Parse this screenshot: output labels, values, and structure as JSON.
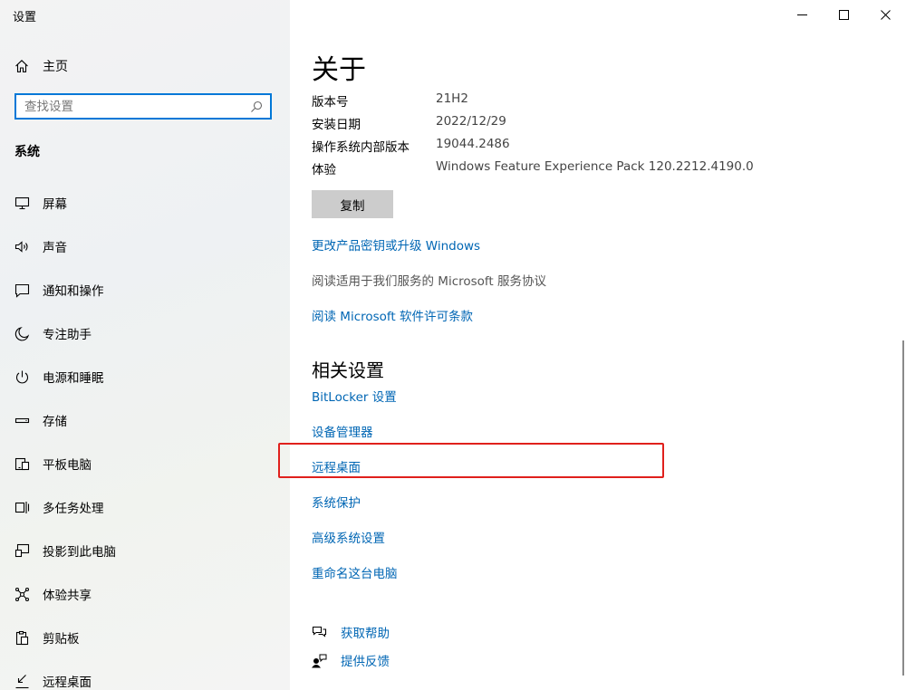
{
  "window": {
    "title": "设置"
  },
  "sidebar": {
    "home_label": "主页",
    "search_placeholder": "查找设置",
    "section": "系统",
    "items": [
      {
        "label": "屏幕",
        "icon": "monitor-icon"
      },
      {
        "label": "声音",
        "icon": "speaker-icon"
      },
      {
        "label": "通知和操作",
        "icon": "notification-icon"
      },
      {
        "label": "专注助手",
        "icon": "moon-icon"
      },
      {
        "label": "电源和睡眠",
        "icon": "power-icon"
      },
      {
        "label": "存储",
        "icon": "storage-icon"
      },
      {
        "label": "平板电脑",
        "icon": "tablet-icon"
      },
      {
        "label": "多任务处理",
        "icon": "multitasking-icon"
      },
      {
        "label": "投影到此电脑",
        "icon": "project-icon"
      },
      {
        "label": "体验共享",
        "icon": "share-icon"
      },
      {
        "label": "剪贴板",
        "icon": "clipboard-icon"
      },
      {
        "label": "远程桌面",
        "icon": "remote-desktop-icon"
      }
    ]
  },
  "main": {
    "title": "关于",
    "specs": [
      {
        "key": "版本号",
        "value": "21H2"
      },
      {
        "key": "安装日期",
        "value": "2022/12/29"
      },
      {
        "key": "操作系统内部版本",
        "value": "19044.2486"
      },
      {
        "key": "体验",
        "value": "Windows Feature Experience Pack 120.2212.4190.0"
      }
    ],
    "copy_label": "复制",
    "link_product_key": "更改产品密钥或升级 Windows",
    "text_service_agreement": "阅读适用于我们服务的 Microsoft 服务协议",
    "link_license": "阅读 Microsoft 软件许可条款",
    "related_title": "相关设置",
    "related": [
      "BitLocker 设置",
      "设备管理器",
      "远程桌面",
      "系统保护",
      "高级系统设置",
      "重命名这台电脑"
    ],
    "help": [
      {
        "label": "获取帮助",
        "icon": "help-chat-icon"
      },
      {
        "label": "提供反馈",
        "icon": "feedback-icon"
      }
    ]
  },
  "colors": {
    "accent": "#0078d7",
    "link": "#0066b4",
    "highlight": "#e0201c"
  }
}
